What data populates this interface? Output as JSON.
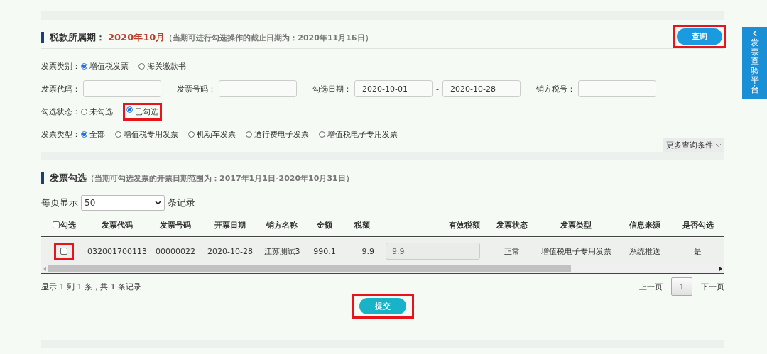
{
  "period": {
    "label": "税款所属期：",
    "value": "2020年10月",
    "note": "（当期可进行勾选操作的截止日期为：2020年11月16日）"
  },
  "query_button": {
    "label": "查询",
    "highlighted": true
  },
  "filters": [
    {
      "kind": "radio",
      "label": "发票类别：",
      "options": [
        {
          "label": "增值税发票",
          "selected": true,
          "highlighted": false
        },
        {
          "label": "海关缴款书",
          "selected": false,
          "highlighted": false
        }
      ]
    },
    {
      "kind": "fields",
      "items": [
        {
          "kind": "field",
          "label": "发票代码："
        },
        {
          "kind": "field",
          "label": "发票号码："
        },
        {
          "kind": "range",
          "label": "勾选日期：",
          "from": "2020-10-01",
          "separator": "-",
          "to": "2020-10-28"
        },
        {
          "kind": "field",
          "label": "销方税号："
        }
      ]
    },
    {
      "kind": "radio",
      "label": "勾选状态：",
      "options": [
        {
          "label": "未勾选",
          "selected": false,
          "highlighted": false
        },
        {
          "label": "已勾选",
          "selected": true,
          "highlighted": true
        }
      ]
    },
    {
      "kind": "radio",
      "label": "发票类型：",
      "options": [
        {
          "label": "全部",
          "selected": true,
          "highlighted": false
        },
        {
          "label": "增值税专用发票",
          "selected": false,
          "highlighted": false
        },
        {
          "label": "机动车发票",
          "selected": false,
          "highlighted": false
        },
        {
          "label": "通行费电子发票",
          "selected": false,
          "highlighted": false
        },
        {
          "label": "增值税电子专用发票",
          "selected": false,
          "highlighted": false
        }
      ]
    }
  ],
  "more_conditions": "更多查询条件",
  "selection": {
    "title": "发票勾选",
    "note": "（当期可勾选发票的开票日期范围为：2017年1月1日-2020年10月31日）"
  },
  "page_size": {
    "prefix": "每页显示",
    "value": "50",
    "suffix": "条记录"
  },
  "table": {
    "select_all": {
      "label": "勾选",
      "checked": false
    },
    "columns": [
      "发票代码",
      "发票号码",
      "开票日期",
      "销方名称",
      "金额",
      "税额",
      "有效税额",
      "发票状态",
      "发票类型",
      "信息来源",
      "是否勾选"
    ],
    "rows": [
      {
        "checked": false,
        "highlighted": true,
        "cells": [
          {
            "kind": "text",
            "text": "032001700113"
          },
          {
            "kind": "text",
            "text": "00000022"
          },
          {
            "kind": "text",
            "text": "2020-10-28"
          },
          {
            "kind": "text",
            "text": "江苏测试3"
          },
          {
            "kind": "text",
            "text": "990.1"
          },
          {
            "kind": "number",
            "text": "9.9"
          },
          {
            "kind": "input",
            "text": "9.9"
          },
          {
            "kind": "text",
            "text": "正常"
          },
          {
            "kind": "text",
            "text": "增值税电子专用发票"
          },
          {
            "kind": "text",
            "text": "系统推送"
          },
          {
            "kind": "text",
            "text": "是"
          }
        ]
      }
    ]
  },
  "summary": "显示 1 到 1 条，共 1 条记录",
  "pagination": {
    "prev": "上一页",
    "pages": [
      {
        "label": "1",
        "selected": true
      }
    ],
    "next": "下一页"
  },
  "submit_button": {
    "label": "提交",
    "highlighted": true
  },
  "side_tab": {
    "label": "发票查验平台"
  }
}
